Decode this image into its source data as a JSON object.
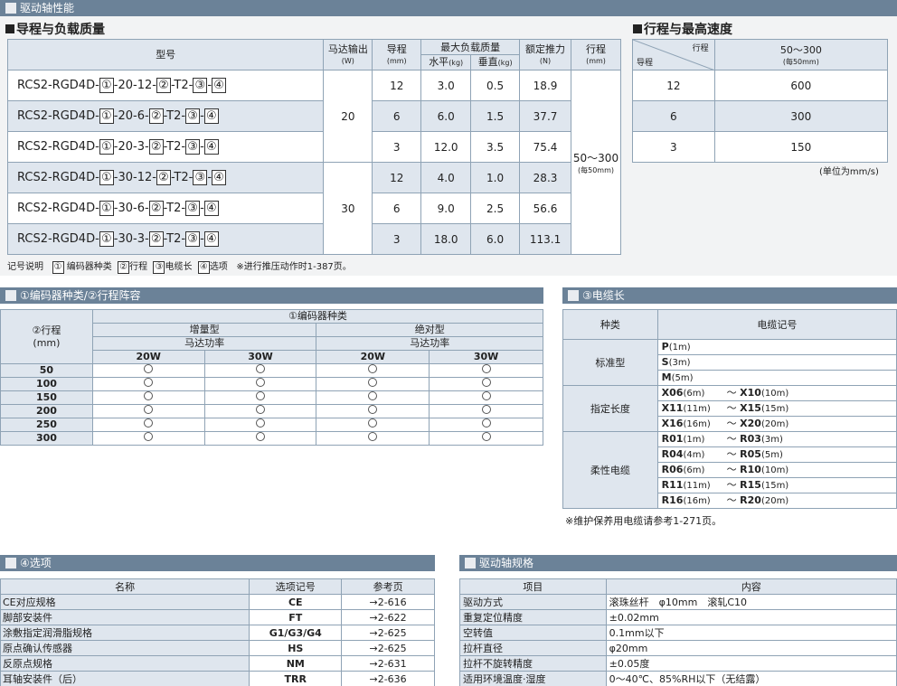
{
  "top_bar": "驱动轴性能",
  "lead_section": {
    "title": "导程与负载质量",
    "headers": {
      "model": "型号",
      "motor": "马达输出",
      "motor_unit": "(W)",
      "lead": "导程",
      "lead_unit": "(mm)",
      "max_load": "最大负载质量",
      "horizontal": "水平",
      "horizontal_unit": "(kg)",
      "vertical": "垂直",
      "vertical_unit": "(kg)",
      "thrust": "额定推力",
      "thrust_unit": "(N)",
      "stroke": "行程",
      "stroke_unit": "(mm)"
    },
    "rows": [
      {
        "prefix": "RCS2-RGD4D-",
        "mid": "-20-12-",
        "lead": "12",
        "h": "3.0",
        "v": "0.5",
        "thrust": "18.9"
      },
      {
        "prefix": "RCS2-RGD4D-",
        "mid": "-20-6-",
        "lead": "6",
        "h": "6.0",
        "v": "1.5",
        "thrust": "37.7"
      },
      {
        "prefix": "RCS2-RGD4D-",
        "mid": "-20-3-",
        "lead": "3",
        "h": "12.0",
        "v": "3.5",
        "thrust": "75.4"
      },
      {
        "prefix": "RCS2-RGD4D-",
        "mid": "-30-12-",
        "lead": "12",
        "h": "4.0",
        "v": "1.0",
        "thrust": "28.3"
      },
      {
        "prefix": "RCS2-RGD4D-",
        "mid": "-30-6-",
        "lead": "6",
        "h": "9.0",
        "v": "2.5",
        "thrust": "56.6"
      },
      {
        "prefix": "RCS2-RGD4D-",
        "mid": "-30-3-",
        "lead": "3",
        "h": "18.0",
        "v": "6.0",
        "thrust": "113.1"
      }
    ],
    "box1": "①",
    "box2": "②",
    "box3": "③",
    "box4": "④",
    "t2": "-T2-",
    "dash": "-",
    "motor_20": "20",
    "motor_30": "30",
    "stroke_value": "50～300",
    "stroke_note": "(每50mm)",
    "legend_label": "记号说明",
    "legend_1": "编码器种类",
    "legend_2": "行程",
    "legend_3": "电缆长",
    "legend_4": "选项",
    "legend_note": "※进行推压动作时1-387页。"
  },
  "speed_section": {
    "title": "行程与最高速度",
    "corner_top": "行程",
    "corner_bottom": "导程",
    "stroke_head": "50～300",
    "stroke_head_note": "(每50mm)",
    "rows": [
      {
        "lead": "12",
        "speed": "600"
      },
      {
        "lead": "6",
        "speed": "300"
      },
      {
        "lead": "3",
        "speed": "150"
      }
    ],
    "unit_note": "(单位为mm/s)"
  },
  "encoder_section": {
    "bar": "①编码器种类/②行程阵容",
    "stroke_head": "②行程",
    "stroke_unit": "(mm)",
    "encoder_head": "①编码器种类",
    "incremental": "增量型",
    "absolute": "绝对型",
    "motor_power": "马达功率",
    "w20": "20W",
    "w30": "30W",
    "strokes": [
      "50",
      "100",
      "150",
      "200",
      "250",
      "300"
    ]
  },
  "cable_section": {
    "bar": "③电缆长",
    "head_kind": "种类",
    "head_code": "电缆记号",
    "standard": "标准型",
    "fixed": "指定长度",
    "robot": "柔性电缆",
    "standard_rows": [
      {
        "code": "P",
        "len": "(1m)"
      },
      {
        "code": "S",
        "len": "(3m)"
      },
      {
        "code": "M",
        "len": "(5m)"
      }
    ],
    "fixed_rows": [
      {
        "a": "X06",
        "al": "(6m)",
        "b": "X10",
        "bl": "(10m)"
      },
      {
        "a": "X11",
        "al": "(11m)",
        "b": "X15",
        "bl": "(15m)"
      },
      {
        "a": "X16",
        "al": "(16m)",
        "b": "X20",
        "bl": "(20m)"
      }
    ],
    "robot_rows": [
      {
        "a": "R01",
        "al": "(1m)",
        "b": "R03",
        "bl": "(3m)"
      },
      {
        "a": "R04",
        "al": "(4m)",
        "b": "R05",
        "bl": "(5m)"
      },
      {
        "a": "R06",
        "al": "(6m)",
        "b": "R10",
        "bl": "(10m)"
      },
      {
        "a": "R11",
        "al": "(11m)",
        "b": "R15",
        "bl": "(15m)"
      },
      {
        "a": "R16",
        "al": "(16m)",
        "b": "R20",
        "bl": "(20m)"
      }
    ],
    "tilde": "～",
    "note": "※维护保养用电缆请参考1-271页。"
  },
  "options_section": {
    "bar": "④选项",
    "head_name": "名称",
    "head_code": "选项记号",
    "head_page": "参考页",
    "rows": [
      {
        "name": "CE对应规格",
        "code": "CE",
        "page": "→2-616"
      },
      {
        "name": "脚部安装件",
        "code": "FT",
        "page": "→2-622"
      },
      {
        "name": "涂敷指定润滑脂规格",
        "code": "G1/G3/G4",
        "page": "→2-625"
      },
      {
        "name": "原点确认传感器",
        "code": "HS",
        "page": "→2-625"
      },
      {
        "name": "反原点规格",
        "code": "NM",
        "page": "→2-631"
      },
      {
        "name": "耳轴安装件（后）",
        "code": "TRR",
        "page": "→2-636"
      }
    ]
  },
  "spec_section": {
    "bar": "驱动轴规格",
    "head_item": "项目",
    "head_content": "内容",
    "rows": [
      {
        "item": "驱动方式",
        "content": "滚珠丝杆　φ10mm　滚轧C10"
      },
      {
        "item": "重复定位精度",
        "content": "±0.02mm"
      },
      {
        "item": "空转值",
        "content": "0.1mm以下"
      },
      {
        "item": "拉杆直径",
        "content": "φ20mm"
      },
      {
        "item": "拉杆不旋转精度",
        "content": "±0.05度"
      },
      {
        "item": "适用环境温度·湿度",
        "content": "0～40℃、85%RH以下（无结露）"
      }
    ]
  }
}
